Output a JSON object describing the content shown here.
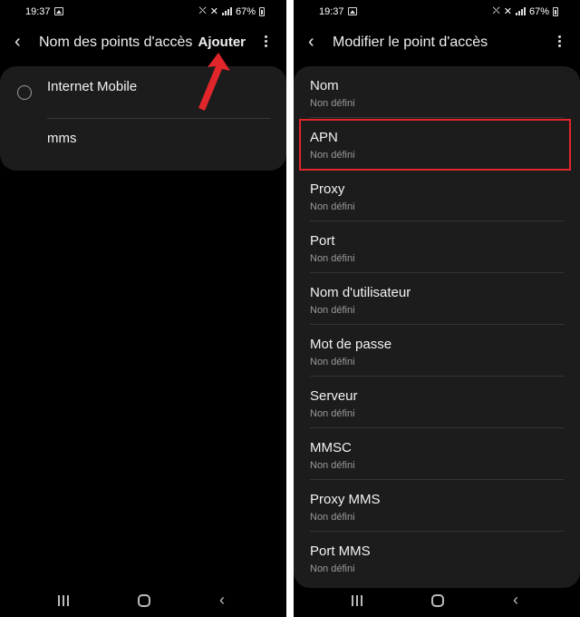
{
  "left_screen": {
    "status": {
      "time": "19:37",
      "battery": "67%"
    },
    "appbar": {
      "title": "Nom des points d'accès",
      "action": "Ajouter"
    },
    "apns": [
      {
        "name": "Internet Mobile"
      },
      {
        "name": "mms"
      }
    ],
    "annotation": {
      "color": "#e0262b",
      "points_to": "Ajouter"
    }
  },
  "right_screen": {
    "status": {
      "time": "19:37",
      "battery": "67%"
    },
    "appbar": {
      "title": "Modifier le point d'accès"
    },
    "fields": [
      {
        "label": "Nom",
        "value": "Non défini"
      },
      {
        "label": "APN",
        "value": "Non défini",
        "highlighted": true
      },
      {
        "label": "Proxy",
        "value": "Non défini"
      },
      {
        "label": "Port",
        "value": "Non défini"
      },
      {
        "label": "Nom d'utilisateur",
        "value": "Non défini"
      },
      {
        "label": "Mot de passe",
        "value": "Non défini"
      },
      {
        "label": "Serveur",
        "value": "Non défini"
      },
      {
        "label": "MMSC",
        "value": "Non défini"
      },
      {
        "label": "Proxy MMS",
        "value": "Non défini"
      },
      {
        "label": "Port MMS",
        "value": "Non défini"
      }
    ]
  },
  "colors": {
    "background": "#000000",
    "card": "#1c1c1c",
    "highlight": "#e0262b"
  },
  "icons": [
    "back-chevron-icon",
    "more-options-icon",
    "recent-apps-icon",
    "home-icon",
    "nav-back-icon",
    "image-notification-icon",
    "mute-icon",
    "signal-icon",
    "battery-icon"
  ]
}
